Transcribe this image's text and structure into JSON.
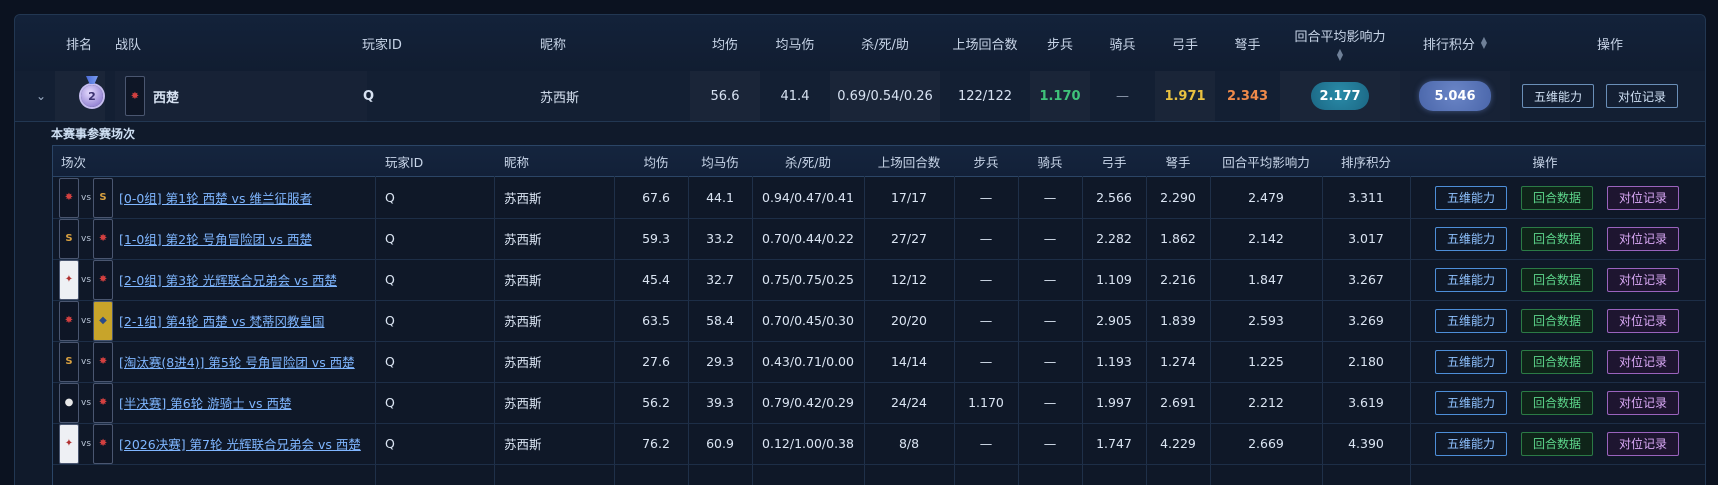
{
  "header": {
    "col_rank": "排名",
    "col_team": "战队",
    "col_player_id": "玩家ID",
    "col_nickname": "昵称",
    "col_avg_dmg": "均伤",
    "col_avg_horse_dmg": "均马伤",
    "col_kda": "杀/死/助",
    "col_rounds": "上场回合数",
    "col_infantry": "步兵",
    "col_cavalry": "骑兵",
    "col_archer": "弓手",
    "col_crossbow": "弩手",
    "col_round_impact": "回合平均影响力",
    "col_rank_score": "排行积分",
    "col_actions": "操作"
  },
  "summary": {
    "rank": "2",
    "team": "西楚",
    "player_id": "Q",
    "nickname": "苏西斯",
    "avg_dmg": "56.6",
    "avg_horse_dmg": "41.4",
    "kda": "0.69/0.54/0.26",
    "rounds": "122/122",
    "infantry": "1.170",
    "cavalry": "—",
    "archer": "1.971",
    "crossbow": "2.343",
    "round_impact": "2.177",
    "rank_score": "5.046",
    "btn_five_dim": "五维能力",
    "btn_matchup": "对位记录"
  },
  "colors": {
    "infantry": "#3fc27a",
    "archer": "#e9c140",
    "crossbow": "#ef8a4a",
    "accent_blue": "#4d8ed8"
  },
  "section": {
    "title": "本赛事参赛场次"
  },
  "inner_header": {
    "col_match": "场次",
    "col_player_id": "玩家ID",
    "col_nickname": "昵称",
    "col_avg_dmg": "均伤",
    "col_avg_horse_dmg": "均马伤",
    "col_kda": "杀/死/助",
    "col_rounds": "上场回合数",
    "col_infantry": "步兵",
    "col_cavalry": "骑兵",
    "col_archer": "弓手",
    "col_crossbow": "弩手",
    "col_round_impact": "回合平均影响力",
    "col_rank_score": "排序积分",
    "col_actions": "操作"
  },
  "row_buttons": {
    "five_dim": "五维能力",
    "round_data": "回合数据",
    "matchup": "对位记录"
  },
  "rows": [
    {
      "vs": "vs",
      "match": "[0-0组] 第1轮 西楚 vs 维兰征服者",
      "player_id": "Q",
      "nickname": "苏西斯",
      "avg_dmg": "67.6",
      "avg_horse_dmg": "44.1",
      "kda": "0.94/0.47/0.41",
      "rounds": "17/17",
      "infantry": "—",
      "cavalry": "—",
      "archer": "2.566",
      "crossbow": "2.290",
      "round_impact": "2.479",
      "rank_score": "3.311"
    },
    {
      "vs": "vs",
      "match": "[1-0组] 第2轮 号角冒险团 vs 西楚",
      "player_id": "Q",
      "nickname": "苏西斯",
      "avg_dmg": "59.3",
      "avg_horse_dmg": "33.2",
      "kda": "0.70/0.44/0.22",
      "rounds": "27/27",
      "infantry": "—",
      "cavalry": "—",
      "archer": "2.282",
      "crossbow": "1.862",
      "round_impact": "2.142",
      "rank_score": "3.017"
    },
    {
      "vs": "vs",
      "match": "[2-0组] 第3轮 光辉联合兄弟会 vs 西楚",
      "player_id": "Q",
      "nickname": "苏西斯",
      "avg_dmg": "45.4",
      "avg_horse_dmg": "32.7",
      "kda": "0.75/0.75/0.25",
      "rounds": "12/12",
      "infantry": "—",
      "cavalry": "—",
      "archer": "1.109",
      "crossbow": "2.216",
      "round_impact": "1.847",
      "rank_score": "3.267"
    },
    {
      "vs": "vs",
      "match": "[2-1组] 第4轮 西楚 vs 梵蒂冈教皇国",
      "player_id": "Q",
      "nickname": "苏西斯",
      "avg_dmg": "63.5",
      "avg_horse_dmg": "58.4",
      "kda": "0.70/0.45/0.30",
      "rounds": "20/20",
      "infantry": "—",
      "cavalry": "—",
      "archer": "2.905",
      "crossbow": "1.839",
      "round_impact": "2.593",
      "rank_score": "3.269"
    },
    {
      "vs": "vs",
      "match": "[淘汰赛(8进4)] 第5轮 号角冒险团 vs 西楚",
      "player_id": "Q",
      "nickname": "苏西斯",
      "avg_dmg": "27.6",
      "avg_horse_dmg": "29.3",
      "kda": "0.43/0.71/0.00",
      "rounds": "14/14",
      "infantry": "—",
      "cavalry": "—",
      "archer": "1.193",
      "crossbow": "1.274",
      "round_impact": "1.225",
      "rank_score": "2.180"
    },
    {
      "vs": "vs",
      "match": "[半决赛] 第6轮 游骑士 vs 西楚",
      "player_id": "Q",
      "nickname": "苏西斯",
      "avg_dmg": "56.2",
      "avg_horse_dmg": "39.3",
      "kda": "0.79/0.42/0.29",
      "rounds": "24/24",
      "infantry": "1.170",
      "cavalry": "—",
      "archer": "1.997",
      "crossbow": "2.691",
      "round_impact": "2.212",
      "rank_score": "3.619"
    },
    {
      "vs": "vs",
      "match": "[2026决赛] 第7轮 光辉联合兄弟会 vs 西楚",
      "player_id": "Q",
      "nickname": "苏西斯",
      "avg_dmg": "76.2",
      "avg_horse_dmg": "60.9",
      "kda": "0.12/1.00/0.38",
      "rounds": "8/8",
      "infantry": "—",
      "cavalry": "—",
      "archer": "1.747",
      "crossbow": "4.229",
      "round_impact": "2.669",
      "rank_score": "4.390"
    }
  ]
}
